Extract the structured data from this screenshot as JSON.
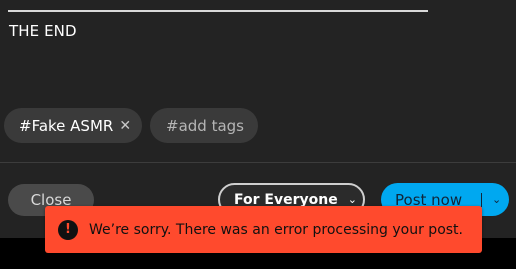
{
  "post": {
    "ending_text": "THE END"
  },
  "tags": {
    "existing": [
      {
        "label": "#Fake ASMR",
        "remove_icon": "close-x-icon"
      }
    ],
    "add_placeholder": "#add tags"
  },
  "footer": {
    "close_label": "Close",
    "audience_label": "For Everyone",
    "post_label": "Post now"
  },
  "toast": {
    "icon": "alert-icon",
    "message": "We’re sorry. There was an error processing your post.",
    "color": "#ff4a2d"
  },
  "colors": {
    "panel_bg": "#232323",
    "chip_bg": "#3a3a3a",
    "post_button": "#00a8f0"
  }
}
